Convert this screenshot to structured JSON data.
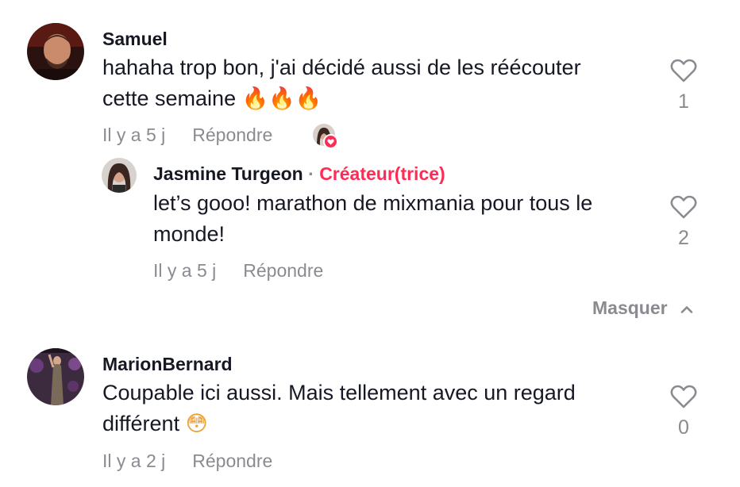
{
  "comments": [
    {
      "username": "Samuel",
      "text_line1": "hahaha trop bon, j'ai décidé aussi de les réécouter",
      "text_line2": "cette semaine",
      "emoji": "🔥🔥🔥",
      "time": "Il y a 5 j",
      "reply_label": "Répondre",
      "like_count": "1",
      "avatar_icon": "user-avatar"
    },
    {
      "username": "Jasmine Turgeon",
      "separator": "·",
      "badge": "Créateur(trice)",
      "text_line1": "let’s gooo! marathon de mixmania pour tous le",
      "text_line2": "monde!",
      "time": "Il y a 5 j",
      "reply_label": "Répondre",
      "like_count": "2",
      "avatar_icon": "user-avatar"
    },
    {
      "username": "MarionBernard",
      "text_line1": "Coupable ici aussi. Mais tellement avec un regard",
      "text_line2": "différent",
      "emoji": "😳",
      "time": "Il y a 2 j",
      "reply_label": "Répondre",
      "like_count": "0",
      "avatar_icon": "user-avatar"
    }
  ],
  "hide_replies_label": "Masquer",
  "colors": {
    "accent": "#fe2c55",
    "secondary_text": "#8a8b91",
    "primary_text": "#161823"
  }
}
